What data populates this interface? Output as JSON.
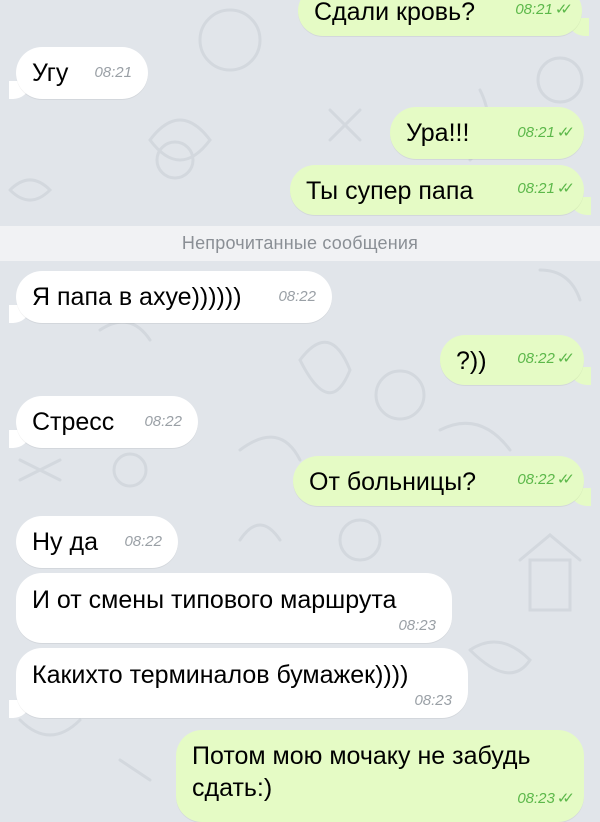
{
  "colors": {
    "background": "#e1e5ea",
    "incoming": "#ffffff",
    "outgoing": "#e5fbc5",
    "read_ticks": "#5cb84a"
  },
  "messages": [
    {
      "text": "Сдали кровь?",
      "time": "08:21",
      "dir": "out"
    },
    {
      "text": "Угу",
      "time": "08:21",
      "dir": "in"
    },
    {
      "text": "Ура!!!",
      "time": "08:21",
      "dir": "out"
    },
    {
      "text": "Ты супер папа",
      "time": "08:21",
      "dir": "out"
    },
    {
      "text": "Я папа в ахуе))))))",
      "time": "08:22",
      "dir": "in"
    },
    {
      "text": "?))",
      "time": "08:22",
      "dir": "out"
    },
    {
      "text": "Стресс",
      "time": "08:22",
      "dir": "in"
    },
    {
      "text": "От больницы?",
      "time": "08:22",
      "dir": "out"
    },
    {
      "text": "Ну да",
      "time": "08:22",
      "dir": "in"
    },
    {
      "text": "И от смены типового маршрута",
      "time": "08:23",
      "dir": "in"
    },
    {
      "text": "Какихто терминалов бумажек))))",
      "time": "08:23",
      "dir": "in"
    },
    {
      "text": "Потом мою мочаку не забудь сдать:)",
      "time": "08:23",
      "dir": "out"
    }
  ],
  "unread_divider": "Непрочитанные сообщения",
  "read_ticks_icon": "double-check-icon"
}
